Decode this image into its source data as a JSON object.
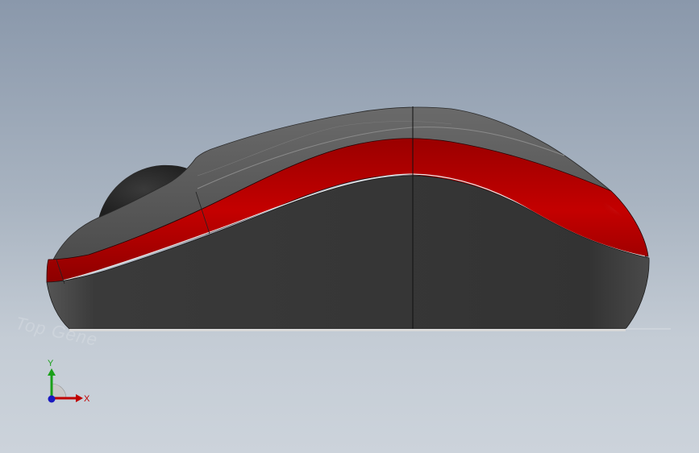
{
  "viewport": {
    "background_top": "#8a98ab",
    "background_bottom": "#ccd3db"
  },
  "model": {
    "body_color": "#3a3a3a",
    "accent_color": "#b50000",
    "shell_color": "#5e5e5e"
  },
  "watermark": {
    "text": "Top Gene"
  },
  "triad": {
    "x_label": "X",
    "y_label": "Y",
    "x_color": "#c00000",
    "y_color": "#1aa01a",
    "z_color": "#1a1ac0"
  }
}
